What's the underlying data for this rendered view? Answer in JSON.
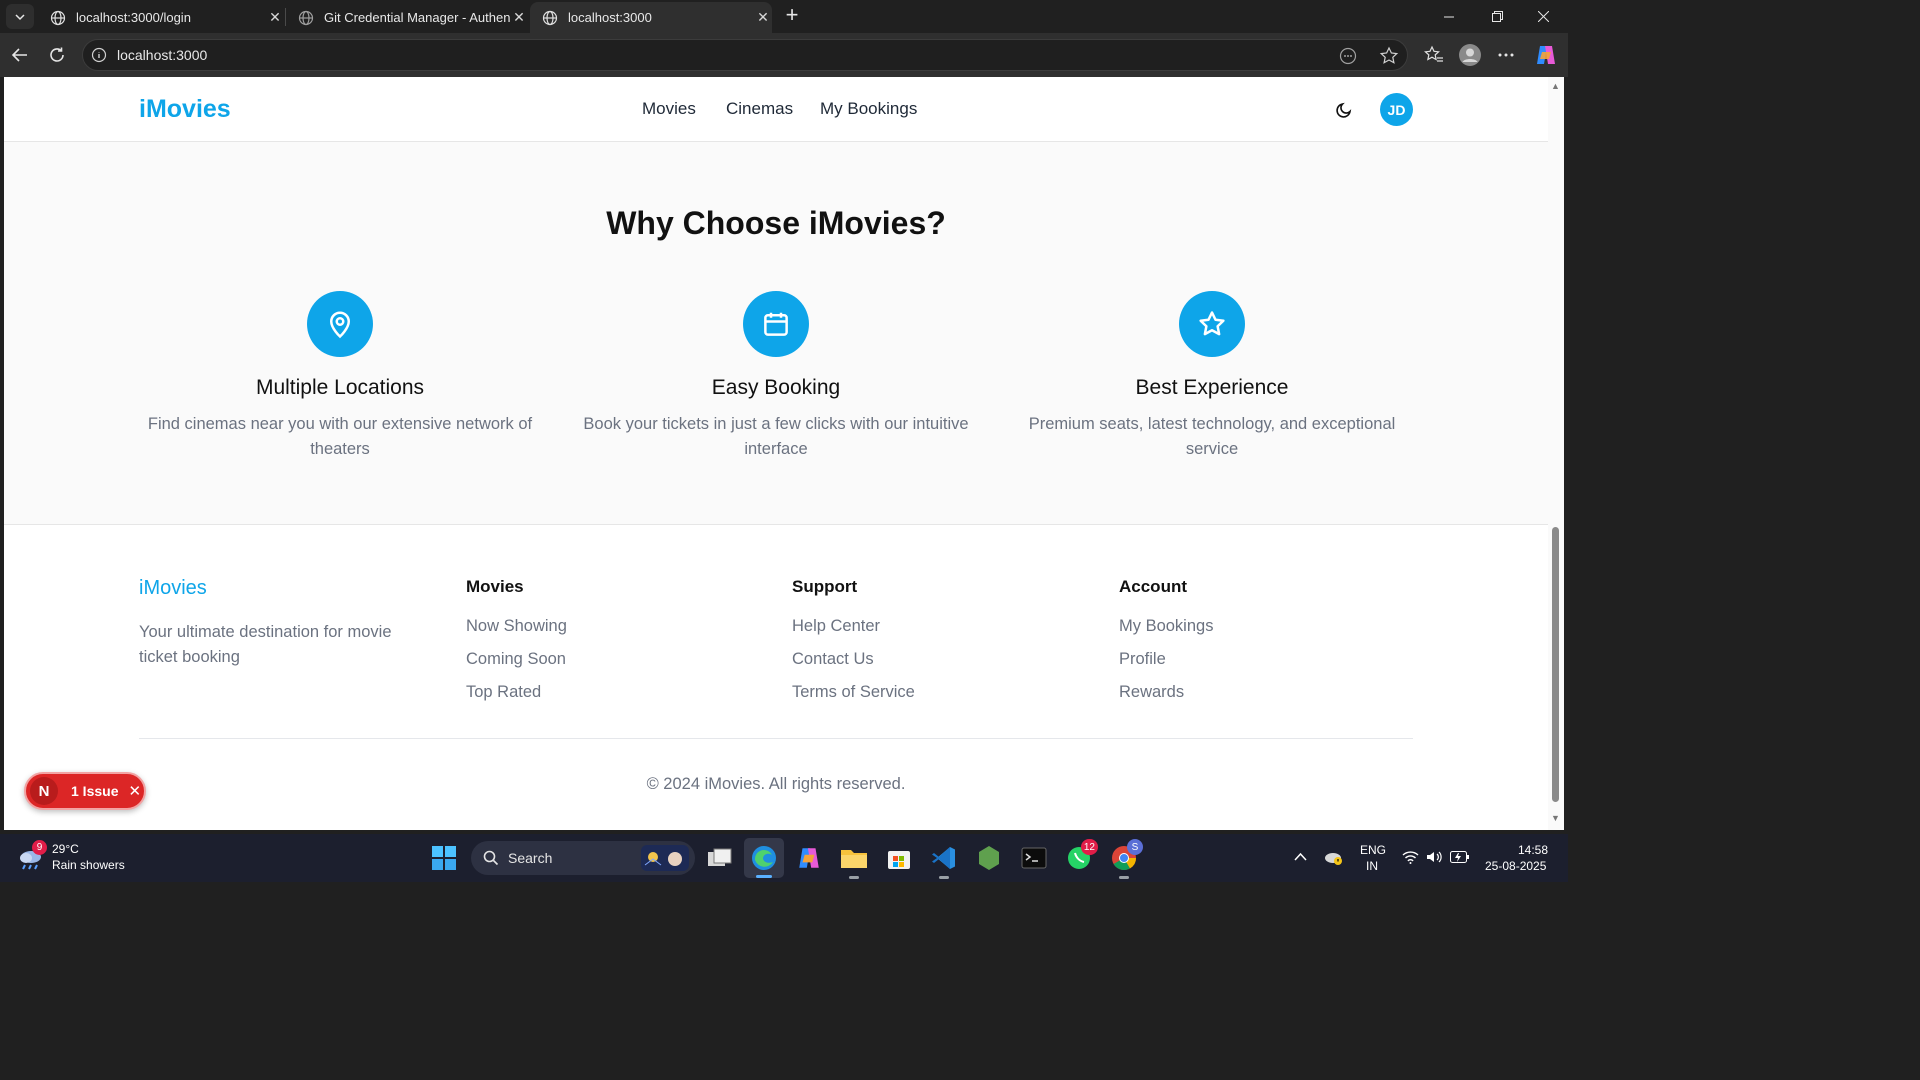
{
  "browser": {
    "tabs": [
      {
        "title": "localhost:3000/login",
        "active": false
      },
      {
        "title": "Git Credential Manager - Authent",
        "active": false
      },
      {
        "title": "localhost:3000",
        "active": true
      }
    ],
    "address": "localhost:3000"
  },
  "header": {
    "logo": "iMovies",
    "nav": [
      "Movies",
      "Cinemas",
      "My Bookings"
    ],
    "avatar_initials": "JD"
  },
  "why": {
    "title": "Why Choose iMovies?",
    "features": [
      {
        "icon": "map-pin-icon",
        "title": "Multiple Locations",
        "desc": "Find cinemas near you with our extensive network of theaters"
      },
      {
        "icon": "calendar-icon",
        "title": "Easy Booking",
        "desc": "Book your tickets in just a few clicks with our intuitive interface"
      },
      {
        "icon": "star-icon",
        "title": "Best Experience",
        "desc": "Premium seats, latest technology, and exceptional service"
      }
    ]
  },
  "footer": {
    "brand": "iMovies",
    "tagline": "Your ultimate destination for movie ticket booking",
    "columns": [
      {
        "heading": "Movies",
        "links": [
          "Now Showing",
          "Coming Soon",
          "Top Rated"
        ]
      },
      {
        "heading": "Support",
        "links": [
          "Help Center",
          "Contact Us",
          "Terms of Service"
        ]
      },
      {
        "heading": "Account",
        "links": [
          "My Bookings",
          "Profile",
          "Rewards"
        ]
      }
    ],
    "copyright": "© 2024 iMovies. All rights reserved."
  },
  "dev_overlay": {
    "letter": "N",
    "label": "1 Issue"
  },
  "taskbar": {
    "weather": {
      "badge": "9",
      "temp": "29°C",
      "desc": "Rain showers"
    },
    "search_label": "Search",
    "whatsapp_badge": "12",
    "chrome_badge": "S",
    "language": "ENG",
    "region": "IN",
    "time": "14:58",
    "date": "25-08-2025"
  },
  "colors": {
    "accent": "#0ea5e9",
    "issue": "#dc2626"
  }
}
